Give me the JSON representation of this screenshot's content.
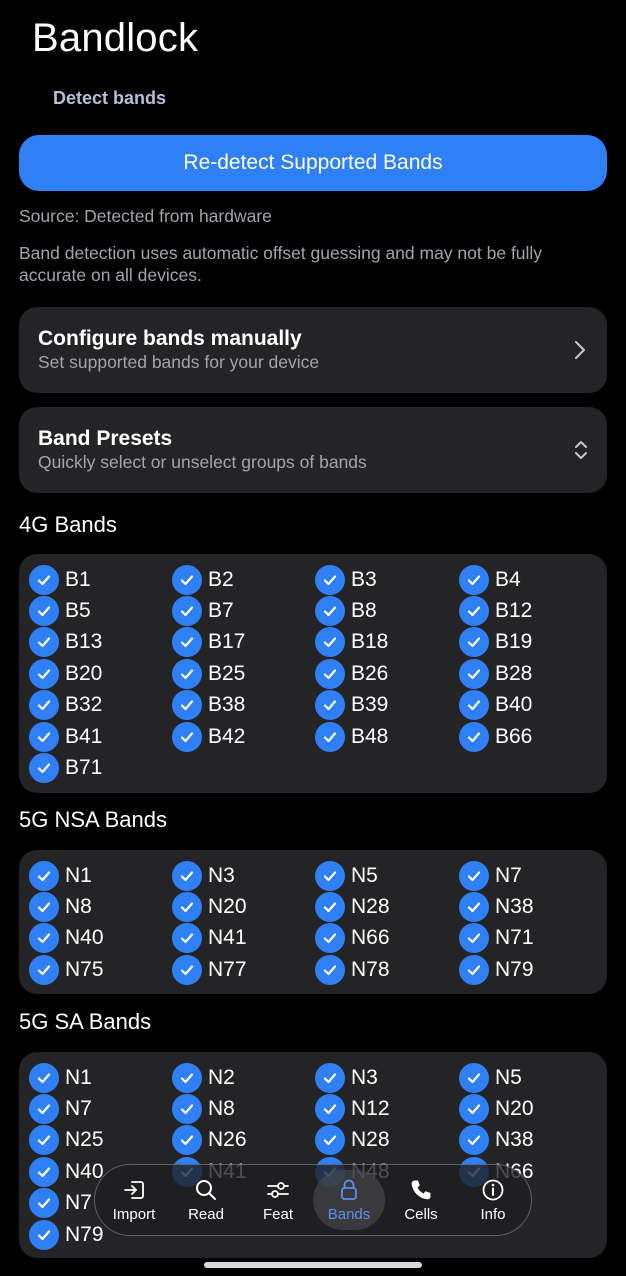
{
  "header": {
    "title": "Bandlock",
    "subtitle": "Detect bands"
  },
  "detect": {
    "button_label": "Re-detect Supported Bands",
    "source": "Source: Detected from hardware",
    "warning": "Band detection uses automatic offset guessing and may not be fully accurate on all devices."
  },
  "manual": {
    "title": "Configure bands manually",
    "desc": "Set supported bands for your device",
    "icon": "chevron-right-icon"
  },
  "presets": {
    "title": "Band Presets",
    "desc": "Quickly select or unselect groups of bands",
    "icon": "expand-icon"
  },
  "lte": {
    "title": "4G Bands",
    "bands": [
      "B1",
      "B2",
      "B3",
      "B4",
      "B5",
      "B7",
      "B8",
      "B12",
      "B13",
      "B17",
      "B18",
      "B19",
      "B20",
      "B25",
      "B26",
      "B28",
      "B32",
      "B38",
      "B39",
      "B40",
      "B41",
      "B42",
      "B48",
      "B66",
      "B71"
    ]
  },
  "nsa": {
    "title": "5G NSA Bands",
    "bands": [
      "N1",
      "N3",
      "N5",
      "N7",
      "N8",
      "N20",
      "N28",
      "N38",
      "N40",
      "N41",
      "N66",
      "N71",
      "N75",
      "N77",
      "N78",
      "N79"
    ]
  },
  "sa": {
    "title": "5G SA Bands",
    "bands": [
      "N1",
      "N2",
      "N3",
      "N5",
      "N7",
      "N8",
      "N12",
      "N20",
      "N25",
      "N26",
      "N28",
      "N38",
      "N40",
      "N41",
      "N48",
      "N66",
      "N7",
      "",
      "",
      "",
      "N79"
    ]
  },
  "nav": {
    "items": [
      {
        "label": "Import",
        "icon": "import-icon"
      },
      {
        "label": "Read",
        "icon": "search-icon"
      },
      {
        "label": "Feat",
        "icon": "sliders-icon"
      },
      {
        "label": "Bands",
        "icon": "lock-icon"
      },
      {
        "label": "Cells",
        "icon": "phone-icon"
      },
      {
        "label": "Info",
        "icon": "info-icon"
      }
    ],
    "active": "Bands"
  },
  "colors": {
    "accent": "#2f80f6",
    "card": "#242426",
    "muted_text": "#a2a4aa",
    "subheading": "#b9bed8",
    "active_nav": "#5b8ff0"
  }
}
